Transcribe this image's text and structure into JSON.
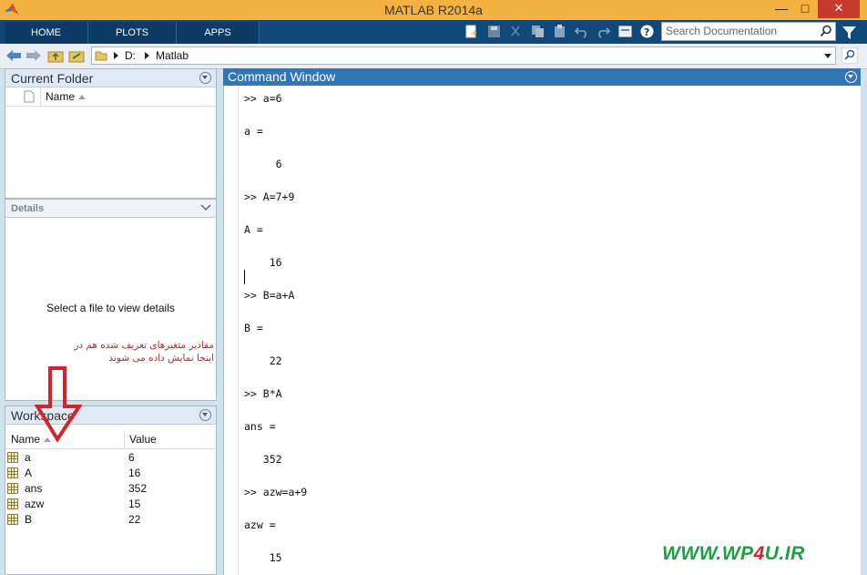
{
  "window": {
    "title": "MATLAB R2014a",
    "minimize": "—",
    "maximize": "□",
    "close": "✕"
  },
  "ribbon": {
    "tabs": [
      "HOME",
      "PLOTS",
      "APPS"
    ]
  },
  "search": {
    "placeholder": "Search Documentation"
  },
  "address": {
    "drive": "D:",
    "folder": "Matlab"
  },
  "current_folder": {
    "title": "Current Folder",
    "name_col": "Name"
  },
  "details": {
    "title": "Details",
    "empty_text": "Select a file to view details"
  },
  "annotation": {
    "line1": "مقادیر متغیرهای تعریف شده هم در",
    "line2": "اینجا نمایش داده می شوند"
  },
  "workspace": {
    "title": "Workspace",
    "columns": [
      "Name",
      "Value"
    ],
    "rows": [
      {
        "name": "a",
        "value": "6"
      },
      {
        "name": "A",
        "value": "16"
      },
      {
        "name": "ans",
        "value": "352"
      },
      {
        "name": "azw",
        "value": "15"
      },
      {
        "name": "B",
        "value": "22"
      }
    ]
  },
  "command_window": {
    "title": "Command Window",
    "lines": [
      ">> a=6",
      "a =",
      "     6",
      ">> A=7+9",
      "A =",
      "    16",
      ">> B=a+A",
      "B =",
      "    22",
      ">> B*A",
      "ans =",
      "   352",
      ">> azw=a+9",
      "azw =",
      "    15"
    ]
  },
  "watermark": {
    "pre": "WWW.WP",
    "num": "4",
    "post": "U.IR"
  },
  "colors": {
    "ribbon": "#11487a",
    "titlebar": "#f3b13f",
    "cmd_header": "#2f77b8",
    "annotation": "#c0282a",
    "watermark": "#1aa142"
  }
}
